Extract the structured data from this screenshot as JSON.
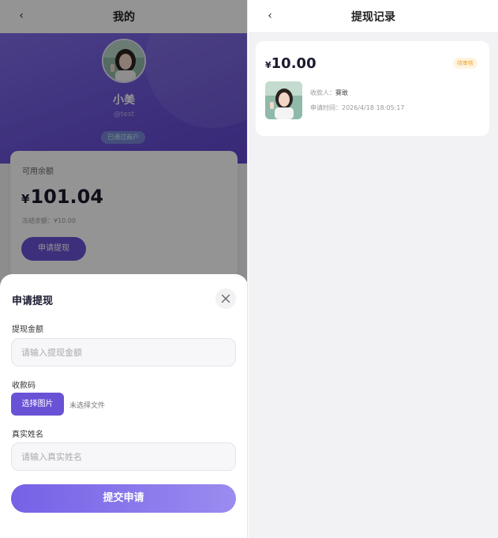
{
  "left_panel": {
    "header": {
      "back_glyph": "‹",
      "title": "我的"
    },
    "profile": {
      "name": "小美",
      "handle": "@test",
      "badge": "已通过商户"
    },
    "balance_card": {
      "label": "可用余额",
      "currency": "¥",
      "amount": "101.04",
      "frozen": "冻结余额：¥10.00",
      "withdraw_button": "申请提现"
    }
  },
  "withdraw_sheet": {
    "title": "申请提现",
    "close_icon": "×",
    "amount_label": "提现金额",
    "amount_placeholder": "请输入提现金额",
    "qrcode_label": "收款码",
    "choose_file_button": "选择图片",
    "no_file_text": "未选择文件",
    "realname_label": "真实姓名",
    "realname_placeholder": "请输入真实姓名",
    "submit_button": "提交申请"
  },
  "right_panel": {
    "header": {
      "back_glyph": "‹",
      "title": "提现记录"
    },
    "record": {
      "currency": "¥",
      "amount": "10.00",
      "status": "待审核",
      "payee_label": "收款人：",
      "payee_value": "賽敢",
      "time_label": "申请时间：",
      "time_value": "2026/4/18 18:05:17"
    }
  },
  "colors": {
    "accent": "#6a52d6",
    "accent_light": "#9a8cf0",
    "status_pending": "#f0a22e"
  }
}
